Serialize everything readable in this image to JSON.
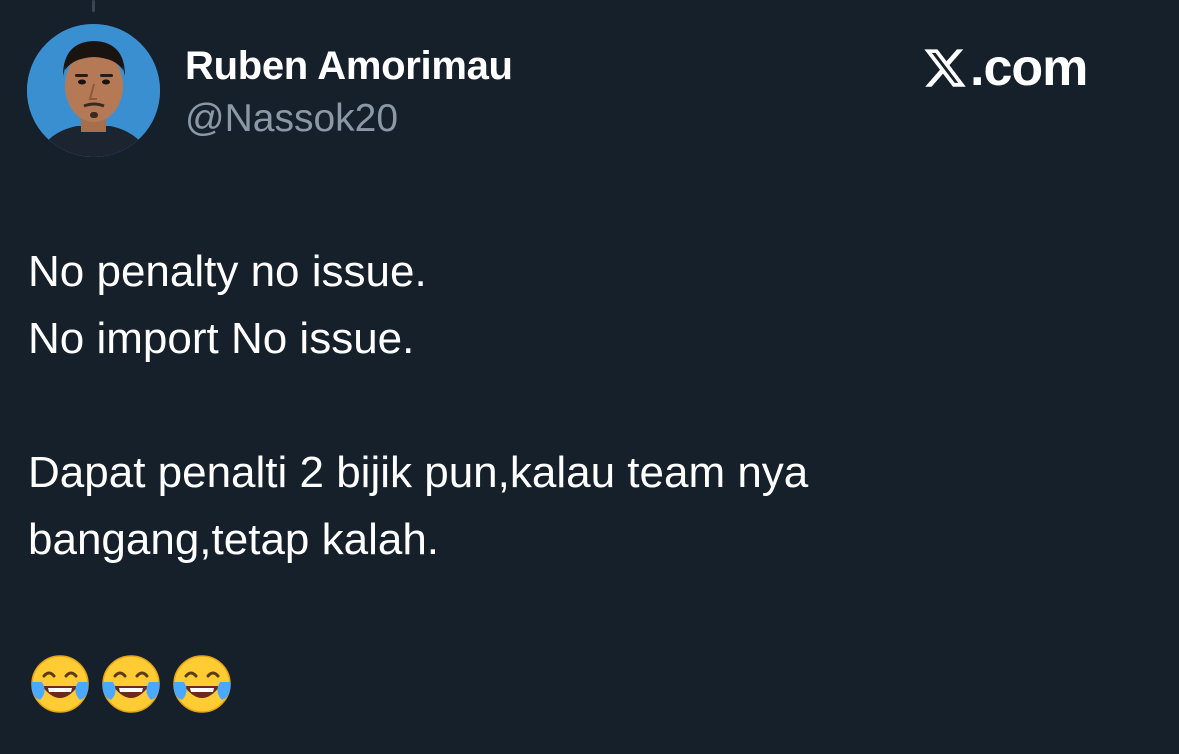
{
  "author": {
    "display_name": "Ruben Amorimau",
    "handle": "@Nassok20",
    "avatar": "avatar-photo"
  },
  "brand": {
    "logo_icon": "x-logo-icon",
    "site_suffix": ".com"
  },
  "tweet": {
    "lines": [
      "No penalty no issue.",
      "No import No issue.",
      "",
      "Dapat penalti 2 bijik pun,kalau team nya",
      "bangang,tetap kalah.",
      ""
    ],
    "emojis": [
      "face-with-tears-of-joy-icon",
      "face-with-tears-of-joy-icon",
      "face-with-tears-of-joy-icon"
    ]
  },
  "colors": {
    "background": "#16202b",
    "text": "#ffffff",
    "muted": "#8b98a5",
    "avatar_bg": "#3a8fd1"
  }
}
